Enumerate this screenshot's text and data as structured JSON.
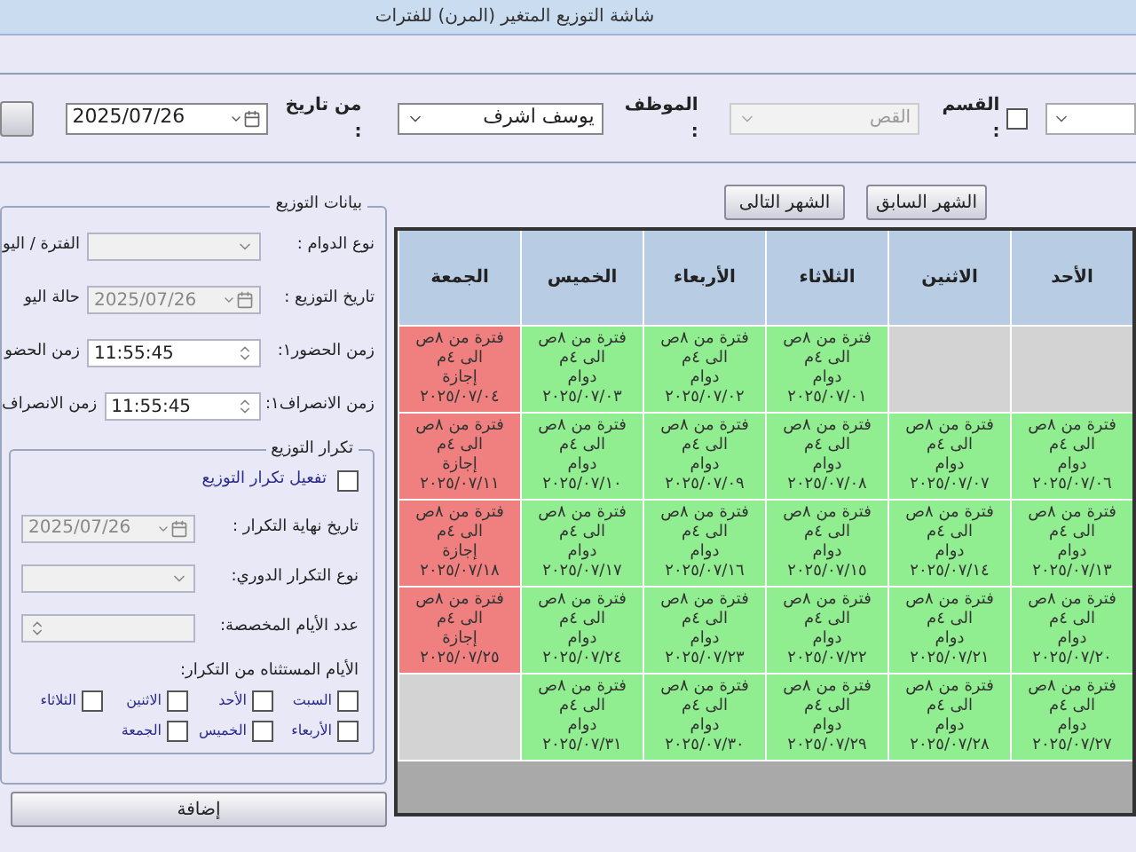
{
  "window": {
    "title": "شاشة التوزيع المتغير (المرن) للفترات"
  },
  "toolbar": {
    "department": {
      "label": "القسم :",
      "checked": false
    },
    "department_field": {
      "value": "القص",
      "disabled": true
    },
    "employee_label": "الموظف :",
    "employee_field": {
      "value": "يوسف اشرف"
    },
    "from_date_label": "من تاريخ :",
    "from_date_field": {
      "value": "2025/07/26"
    }
  },
  "month_buttons": [
    {
      "label": "الشهر السابق"
    },
    {
      "label": "الشهر التالى"
    }
  ],
  "calendar": {
    "columns": [
      "الأحد",
      "الاثنين",
      "الثلاثاء",
      "الأربعاء",
      "الخميس",
      "الجمعة"
    ],
    "rows": [
      {
        "cells": [
          {
            "kind": "empty"
          },
          {
            "kind": "empty"
          },
          {
            "kind": "shift",
            "color": "#90ee90",
            "lines": [
              "فترة من ٨ص",
              "الى ٤م",
              "دوام",
              "٢٠٢٥/٠٧/٠١"
            ]
          },
          {
            "kind": "shift",
            "color": "#90ee90",
            "lines": [
              "فترة من ٨ص",
              "الى ٤م",
              "دوام",
              "٢٠٢٥/٠٧/٠٢"
            ]
          },
          {
            "kind": "shift",
            "color": "#90ee90",
            "lines": [
              "فترة من ٨ص",
              "الى ٤م",
              "دوام",
              "٢٠٢٥/٠٧/٠٣"
            ]
          },
          {
            "kind": "shift",
            "color": "#f08080",
            "lines": [
              "فترة من ٨ص",
              "الى ٤م",
              "إجازة",
              "٢٠٢٥/٠٧/٠٤"
            ]
          }
        ]
      },
      {
        "cells": [
          {
            "kind": "shift",
            "color": "#90ee90",
            "lines": [
              "فترة من ٨ص",
              "الى ٤م",
              "دوام",
              "٢٠٢٥/٠٧/٠٦"
            ]
          },
          {
            "kind": "shift",
            "color": "#90ee90",
            "lines": [
              "فترة من ٨ص",
              "الى ٤م",
              "دوام",
              "٢٠٢٥/٠٧/٠٧"
            ]
          },
          {
            "kind": "shift",
            "color": "#90ee90",
            "lines": [
              "فترة من ٨ص",
              "الى ٤م",
              "دوام",
              "٢٠٢٥/٠٧/٠٨"
            ]
          },
          {
            "kind": "shift",
            "color": "#90ee90",
            "lines": [
              "فترة من ٨ص",
              "الى ٤م",
              "دوام",
              "٢٠٢٥/٠٧/٠٩"
            ]
          },
          {
            "kind": "shift",
            "color": "#90ee90",
            "lines": [
              "فترة من ٨ص",
              "الى ٤م",
              "دوام",
              "٢٠٢٥/٠٧/١٠"
            ]
          },
          {
            "kind": "shift",
            "color": "#f08080",
            "lines": [
              "فترة من ٨ص",
              "الى ٤م",
              "إجازة",
              "٢٠٢٥/٠٧/١١"
            ]
          }
        ]
      },
      {
        "cells": [
          {
            "kind": "shift",
            "color": "#90ee90",
            "lines": [
              "فترة من ٨ص",
              "الى ٤م",
              "دوام",
              "٢٠٢٥/٠٧/١٣"
            ]
          },
          {
            "kind": "shift",
            "color": "#90ee90",
            "lines": [
              "فترة من ٨ص",
              "الى ٤م",
              "دوام",
              "٢٠٢٥/٠٧/١٤"
            ]
          },
          {
            "kind": "shift",
            "color": "#90ee90",
            "lines": [
              "فترة من ٨ص",
              "الى ٤م",
              "دوام",
              "٢٠٢٥/٠٧/١٥"
            ]
          },
          {
            "kind": "shift",
            "color": "#90ee90",
            "lines": [
              "فترة من ٨ص",
              "الى ٤م",
              "دوام",
              "٢٠٢٥/٠٧/١٦"
            ]
          },
          {
            "kind": "shift",
            "color": "#90ee90",
            "lines": [
              "فترة من ٨ص",
              "الى ٤م",
              "دوام",
              "٢٠٢٥/٠٧/١٧"
            ]
          },
          {
            "kind": "shift",
            "color": "#f08080",
            "lines": [
              "فترة من ٨ص",
              "الى ٤م",
              "إجازة",
              "٢٠٢٥/٠٧/١٨"
            ]
          }
        ]
      },
      {
        "cells": [
          {
            "kind": "shift",
            "color": "#90ee90",
            "lines": [
              "فترة من ٨ص",
              "الى ٤م",
              "دوام",
              "٢٠٢٥/٠٧/٢٠"
            ]
          },
          {
            "kind": "shift",
            "color": "#90ee90",
            "lines": [
              "فترة من ٨ص",
              "الى ٤م",
              "دوام",
              "٢٠٢٥/٠٧/٢١"
            ]
          },
          {
            "kind": "shift",
            "color": "#90ee90",
            "lines": [
              "فترة من ٨ص",
              "الى ٤م",
              "دوام",
              "٢٠٢٥/٠٧/٢٢"
            ]
          },
          {
            "kind": "shift",
            "color": "#90ee90",
            "lines": [
              "فترة من ٨ص",
              "الى ٤م",
              "دوام",
              "٢٠٢٥/٠٧/٢٣"
            ]
          },
          {
            "kind": "shift",
            "color": "#90ee90",
            "lines": [
              "فترة من ٨ص",
              "الى ٤م",
              "دوام",
              "٢٠٢٥/٠٧/٢٤"
            ]
          },
          {
            "kind": "shift",
            "color": "#f08080",
            "lines": [
              "فترة من ٨ص",
              "الى ٤م",
              "إجازة",
              "٢٠٢٥/٠٧/٢٥"
            ]
          }
        ]
      },
      {
        "cells": [
          {
            "kind": "shift",
            "color": "#90ee90",
            "lines": [
              "فترة من ٨ص",
              "الى ٤م",
              "دوام",
              "٢٠٢٥/٠٧/٢٧"
            ]
          },
          {
            "kind": "shift",
            "color": "#90ee90",
            "lines": [
              "فترة من ٨ص",
              "الى ٤م",
              "دوام",
              "٢٠٢٥/٠٧/٢٨"
            ]
          },
          {
            "kind": "shift",
            "color": "#90ee90",
            "lines": [
              "فترة من ٨ص",
              "الى ٤م",
              "دوام",
              "٢٠٢٥/٠٧/٢٩"
            ]
          },
          {
            "kind": "shift",
            "color": "#90ee90",
            "lines": [
              "فترة من ٨ص",
              "الى ٤م",
              "دوام",
              "٢٠٢٥/٠٧/٣٠"
            ]
          },
          {
            "kind": "shift",
            "color": "#90ee90",
            "lines": [
              "فترة من ٨ص",
              "الى ٤م",
              "دوام",
              "٢٠٢٥/٠٧/٣١"
            ]
          },
          {
            "kind": "empty"
          }
        ]
      }
    ]
  },
  "distribution": {
    "title": "بيانات التوزيع",
    "fields": [
      {
        "label": "نوع الدوام :",
        "kind": "combo",
        "disabled": true,
        "extra_label": "الفترة / اليو"
      },
      {
        "label": "تاريخ التوزيع :",
        "kind": "date",
        "value": "2025/07/26",
        "disabled": true,
        "extra_label": "حالة اليو"
      },
      {
        "label": "زمن الحضور١:",
        "kind": "time",
        "value": "11:55:45",
        "disabled": false,
        "extra_label": "زمن الحضو"
      },
      {
        "label": "زمن الانصراف١:",
        "kind": "time",
        "value": "11:55:45",
        "disabled": false,
        "extra_label": "زمن الانصراف"
      }
    ],
    "repeat": {
      "title": "تكرار التوزيع",
      "enable": {
        "label": "تفعيل تكرار التوزيع",
        "checked": false
      },
      "fields": [
        {
          "label": "تاريخ نهاية التكرار :",
          "kind": "date",
          "value": "2025/07/26",
          "disabled": true
        },
        {
          "label": "نوع التكرار الدوري:",
          "kind": "combo",
          "disabled": true
        },
        {
          "label": "عدد الأيام المخصصة:",
          "kind": "spin",
          "disabled": true
        }
      ],
      "excluded_label": "الأيام المستثناه من التكرار:",
      "excluded_days": [
        {
          "label": "السبت",
          "checked": false
        },
        {
          "label": "الأحد",
          "checked": false
        },
        {
          "label": "الاثنين",
          "checked": false
        },
        {
          "label": "الثلاثاء",
          "checked": false
        },
        {
          "label": "الأربعاء",
          "checked": false
        },
        {
          "label": "الخميس",
          "checked": false
        },
        {
          "label": "الجمعة",
          "checked": false
        }
      ]
    }
  },
  "add_button": {
    "label": "إضافة"
  }
}
